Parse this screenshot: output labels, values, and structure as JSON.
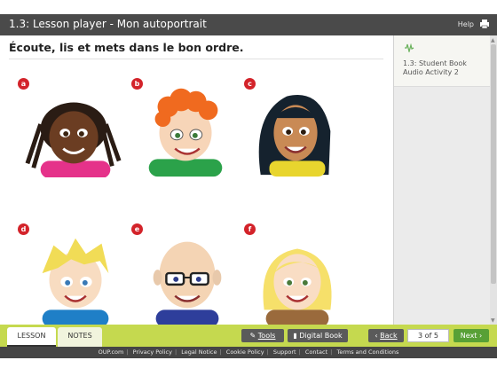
{
  "window": {
    "title": "1.3: Lesson player - Mon autoportrait",
    "help_label": "Help"
  },
  "lesson": {
    "instruction": "Écoute, lis et mets dans le bon ordre.",
    "faces": [
      {
        "badge": "a",
        "hair": "#2a1c14",
        "skin": "#6b3d22",
        "shirt": "#e5328a"
      },
      {
        "badge": "b",
        "hair": "#f06a1f",
        "skin": "#f7d5b8",
        "shirt": "#2ba24a"
      },
      {
        "badge": "c",
        "hair": "#15222e",
        "skin": "#c98a55",
        "shirt": "#e8d52e"
      },
      {
        "badge": "d",
        "hair": "#f1dc56",
        "skin": "#f8dcc1",
        "shirt": "#1f7fc7"
      },
      {
        "badge": "e",
        "hair": "#e8c9ab",
        "skin": "#f4d4b4",
        "shirt": "#2e3e9b"
      },
      {
        "badge": "f",
        "hair": "#f6e06a",
        "skin": "#f9ddc4",
        "shirt": "#9a6a3c"
      }
    ]
  },
  "sidebar": {
    "resource_label": "1.3: Student Book Audio Activity 2",
    "audio_icon": "audio-wave-icon"
  },
  "toolbar": {
    "tab_lesson": "LESSON",
    "tab_notes": "NOTES",
    "tools_label": "Tools",
    "book_label": "Digital Book",
    "back_label": "Back",
    "page_indicator": "3 of 5",
    "next_label": "Next"
  },
  "footer": {
    "links": [
      "OUP.com",
      "Privacy Policy",
      "Legal Notice",
      "Cookie Policy",
      "Support",
      "Contact",
      "Terms and Conditions"
    ]
  },
  "colors": {
    "toolbar_green": "#c5d94f",
    "badge_red": "#d3232a",
    "next_green": "#58a036",
    "titlebar_grey": "#4a4a4a"
  }
}
